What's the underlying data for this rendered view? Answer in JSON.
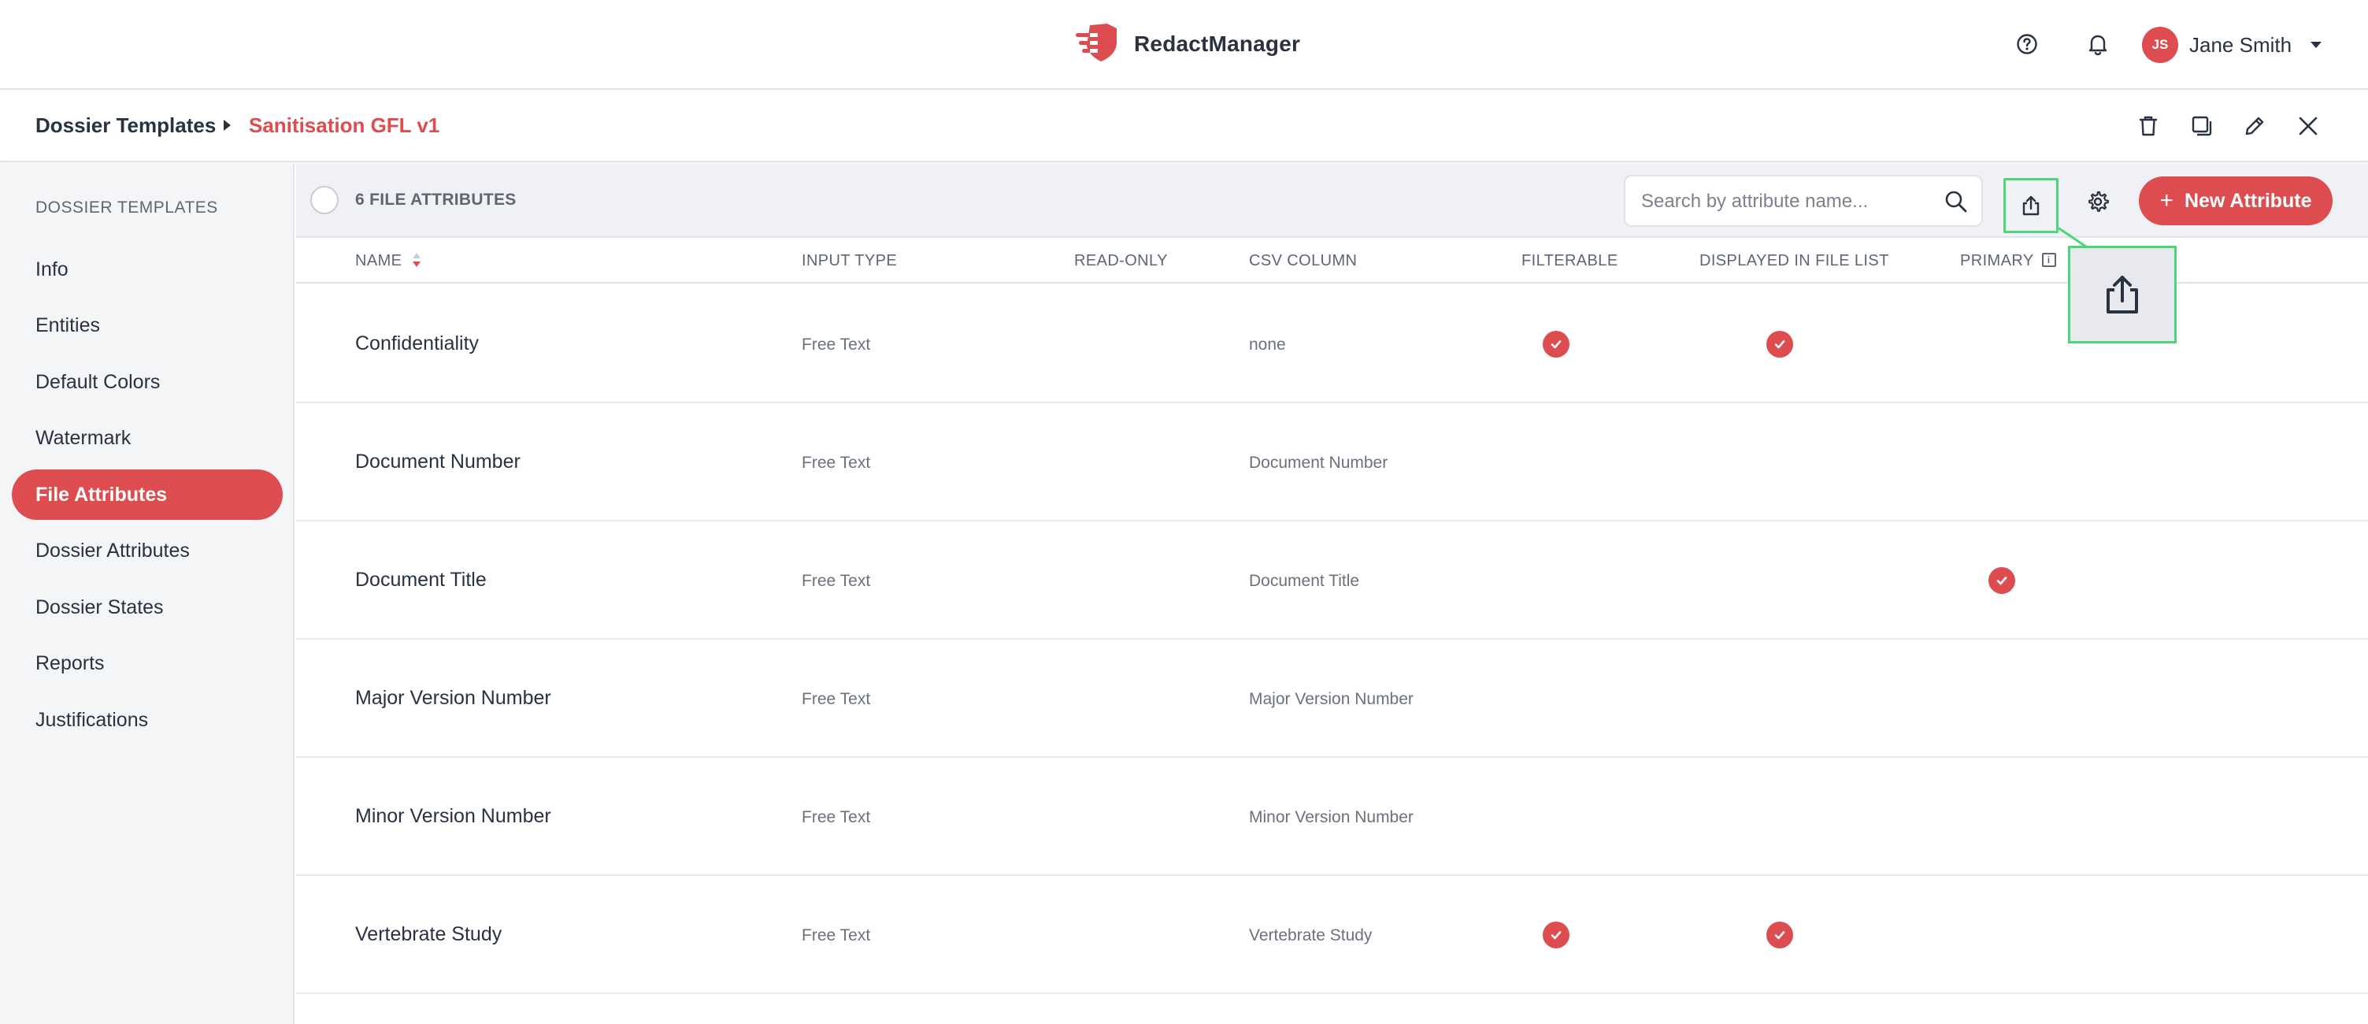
{
  "header": {
    "brand": "RedactManager",
    "user": {
      "initials": "JS",
      "name": "Jane Smith"
    }
  },
  "breadcrumb": {
    "root": "Dossier Templates",
    "current": "Sanitisation GFL v1"
  },
  "sidebar": {
    "heading": "DOSSIER TEMPLATES",
    "items": [
      {
        "label": "Info"
      },
      {
        "label": "Entities"
      },
      {
        "label": "Default Colors"
      },
      {
        "label": "Watermark"
      },
      {
        "label": "File Attributes",
        "active": true
      },
      {
        "label": "Dossier Attributes"
      },
      {
        "label": "Dossier States"
      },
      {
        "label": "Reports"
      },
      {
        "label": "Justifications"
      }
    ]
  },
  "toolbar": {
    "count_label": "6 FILE ATTRIBUTES",
    "search_placeholder": "Search by attribute name...",
    "new_button": "New Attribute"
  },
  "table": {
    "columns": [
      "NAME",
      "INPUT TYPE",
      "READ-ONLY",
      "CSV COLUMN",
      "FILTERABLE",
      "DISPLAYED IN FILE LIST",
      "PRIMARY"
    ],
    "rows": [
      {
        "name": "Confidentiality",
        "input_type": "Free Text",
        "csv": "none",
        "filterable": true,
        "displayed": true,
        "primary": false
      },
      {
        "name": "Document Number",
        "input_type": "Free Text",
        "csv": "Document Number",
        "filterable": false,
        "displayed": false,
        "primary": false
      },
      {
        "name": "Document Title",
        "input_type": "Free Text",
        "csv": "Document Title",
        "filterable": false,
        "displayed": false,
        "primary": true
      },
      {
        "name": "Major Version Number",
        "input_type": "Free Text",
        "csv": "Major Version Number",
        "filterable": false,
        "displayed": false,
        "primary": false
      },
      {
        "name": "Minor Version Number",
        "input_type": "Free Text",
        "csv": "Minor Version Number",
        "filterable": false,
        "displayed": false,
        "primary": false
      },
      {
        "name": "Vertebrate Study",
        "input_type": "Free Text",
        "csv": "Vertebrate Study",
        "filterable": true,
        "displayed": true,
        "primary": false
      }
    ]
  },
  "colors": {
    "accent": "#dd4d50",
    "highlight": "#4cd67b",
    "text": "#283241"
  }
}
